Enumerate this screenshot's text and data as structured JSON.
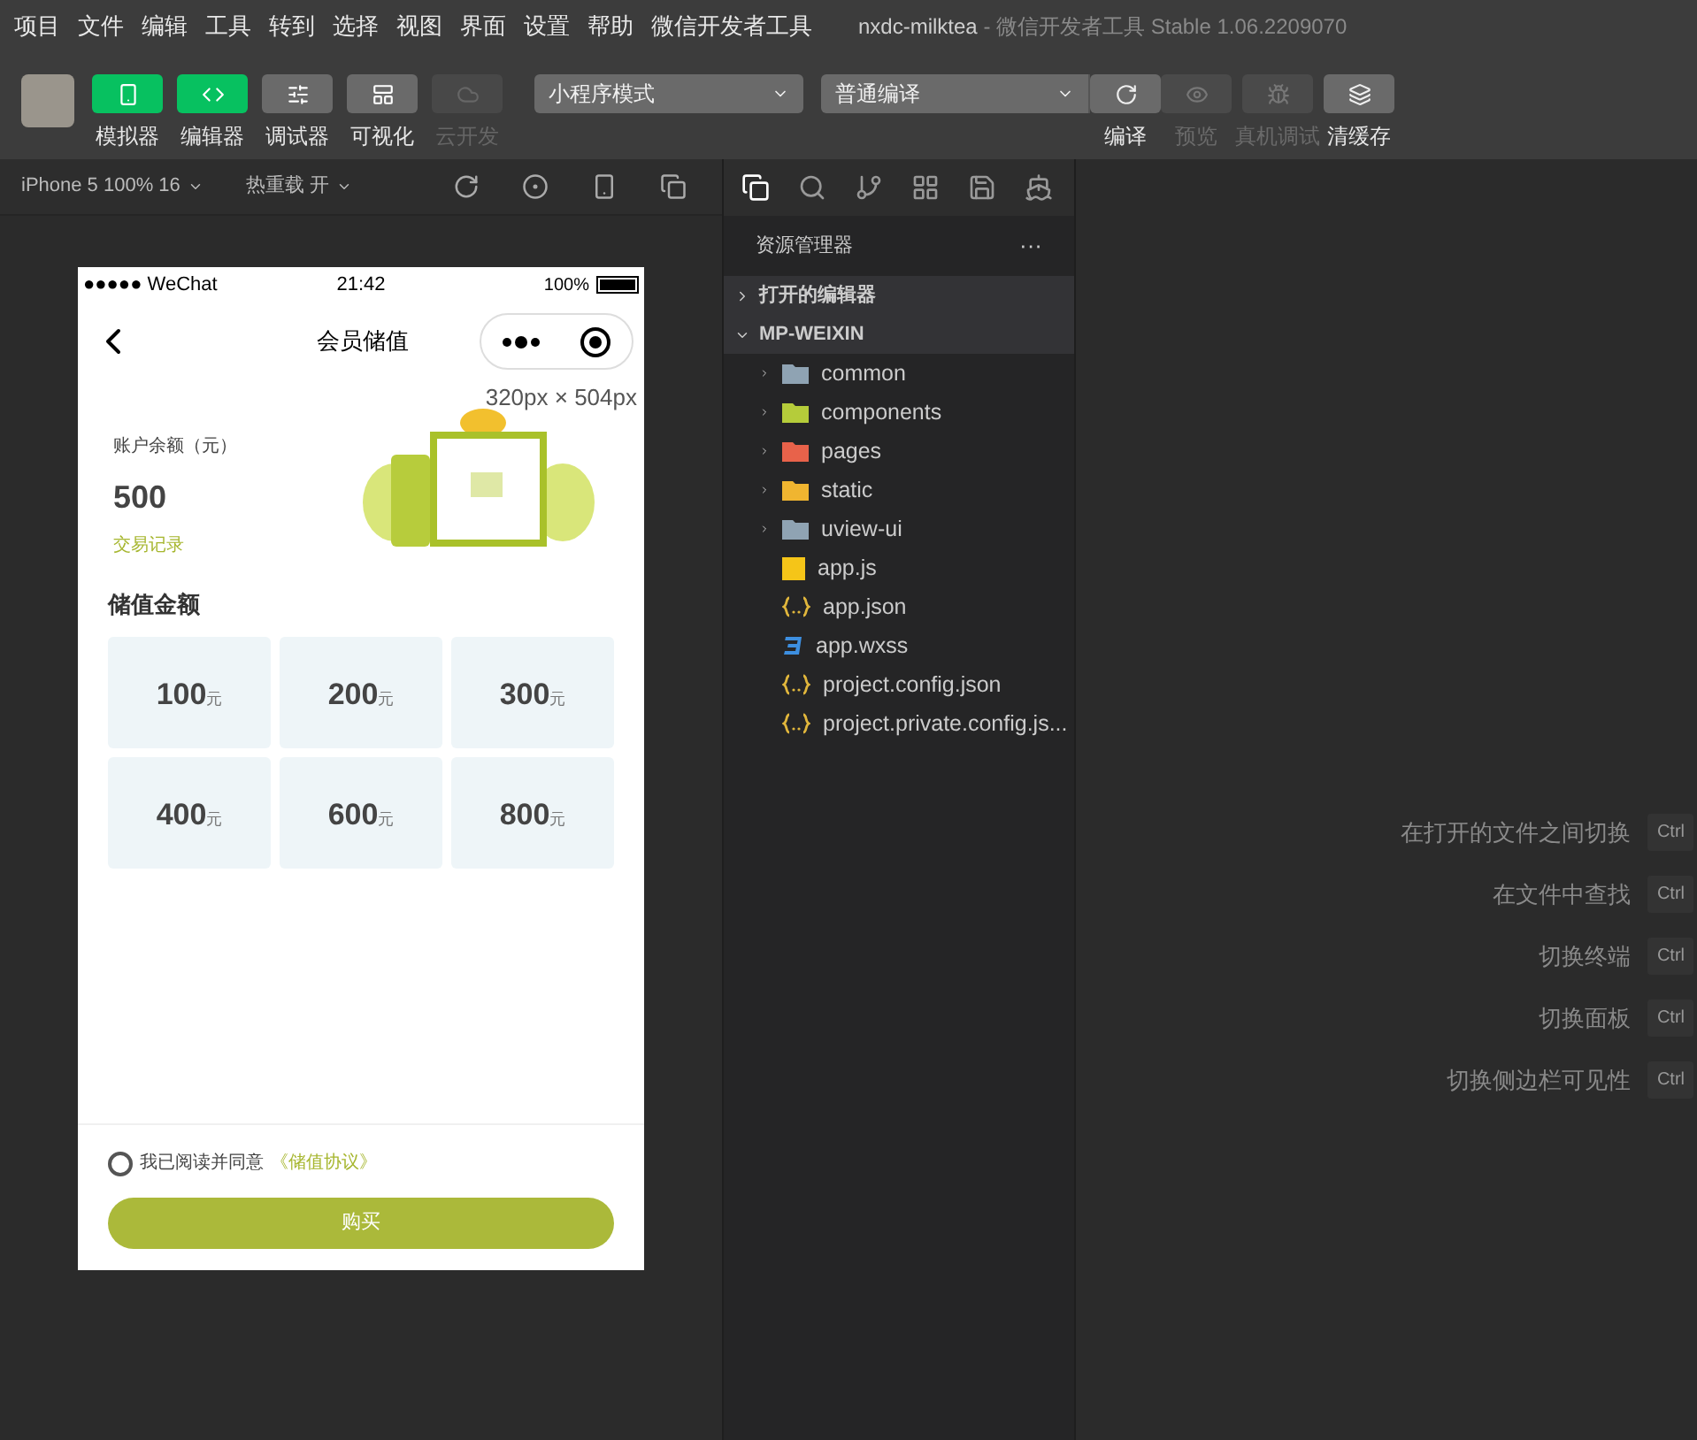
{
  "menu_bar": {
    "items": [
      "项目",
      "文件",
      "编辑",
      "工具",
      "转到",
      "选择",
      "视图",
      "界面",
      "设置",
      "帮助",
      "微信开发者工具"
    ],
    "project": "nxdc-milktea",
    "title": "- 微信开发者工具 Stable 1.06.2209070"
  },
  "toolbar": {
    "view_buttons": [
      {
        "kind": "simulator",
        "label": "模拟器",
        "on": true,
        "disabled": false
      },
      {
        "kind": "editor",
        "label": "编辑器",
        "on": true,
        "disabled": false
      },
      {
        "kind": "debugger",
        "label": "调试器",
        "on": false,
        "disabled": false
      },
      {
        "kind": "visual",
        "label": "可视化",
        "on": false,
        "disabled": false
      },
      {
        "kind": "cloud",
        "label": "云开发",
        "on": false,
        "disabled": true
      }
    ],
    "mode_select": "小程序模式",
    "compile_select": "普通编译",
    "action_buttons": [
      {
        "kind": "compile",
        "label": "编译",
        "disabled": false
      },
      {
        "kind": "preview",
        "label": "预览",
        "disabled": true
      },
      {
        "kind": "device",
        "label": "真机调试",
        "disabled": true
      },
      {
        "kind": "cache",
        "label": "清缓存",
        "disabled": false
      }
    ]
  },
  "simulator_bar": {
    "device": "iPhone 5 100% 16",
    "hot_reload": "热重载 开"
  },
  "phone": {
    "carrier": "●●●●● WeChat",
    "time": "21:42",
    "battery": "100%",
    "nav_title": "会员储值",
    "size_label": "320px × 504px",
    "balance_label": "账户余额（元）",
    "balance": "500",
    "records_link": "交易记录",
    "section_title": "储值金额",
    "amounts": [
      {
        "value": "100",
        "unit": "元",
        "selected": false
      },
      {
        "value": "200",
        "unit": "元",
        "selected": false
      },
      {
        "value": "300",
        "unit": "元",
        "selected": false
      },
      {
        "value": "400",
        "unit": "元",
        "selected": false
      },
      {
        "value": "600",
        "unit": "元",
        "selected": false
      },
      {
        "value": "800",
        "unit": "元",
        "selected": false
      }
    ],
    "agreement": {
      "checked": false,
      "text": "我已阅读并同意",
      "link": "《储值协议》"
    },
    "buy_button": "购买"
  },
  "explorer": {
    "title": "资源管理器",
    "more": "···",
    "sections": [
      {
        "label": "打开的编辑器",
        "expanded": false
      },
      {
        "label": "MP-WEIXIN",
        "expanded": true,
        "children": [
          {
            "kind": "folder",
            "name": "common",
            "color": "#8fa3b3",
            "expanded": false
          },
          {
            "kind": "folder",
            "name": "components",
            "color": "#b5cc3a",
            "expanded": false
          },
          {
            "kind": "folder",
            "name": "pages",
            "color": "#e8624a",
            "expanded": false
          },
          {
            "kind": "folder",
            "name": "static",
            "color": "#f0b530",
            "expanded": false
          },
          {
            "kind": "folder",
            "name": "uview-ui",
            "color": "#8fa3b3",
            "expanded": false
          },
          {
            "kind": "js",
            "name": "app.js"
          },
          {
            "kind": "json",
            "name": "app.json"
          },
          {
            "kind": "wxss",
            "name": "app.wxss"
          },
          {
            "kind": "json",
            "name": "project.config.json"
          },
          {
            "kind": "json",
            "name": "project.private.config.js..."
          }
        ]
      }
    ]
  },
  "shortcuts": [
    {
      "label": "在打开的文件之间切换",
      "key": "Ctrl"
    },
    {
      "label": "在文件中查找",
      "key": "Ctrl"
    },
    {
      "label": "切换终端",
      "key": "Ctrl"
    },
    {
      "label": "切换面板",
      "key": "Ctrl"
    },
    {
      "label": "切换侧边栏可见性",
      "key": "Ctrl"
    }
  ]
}
